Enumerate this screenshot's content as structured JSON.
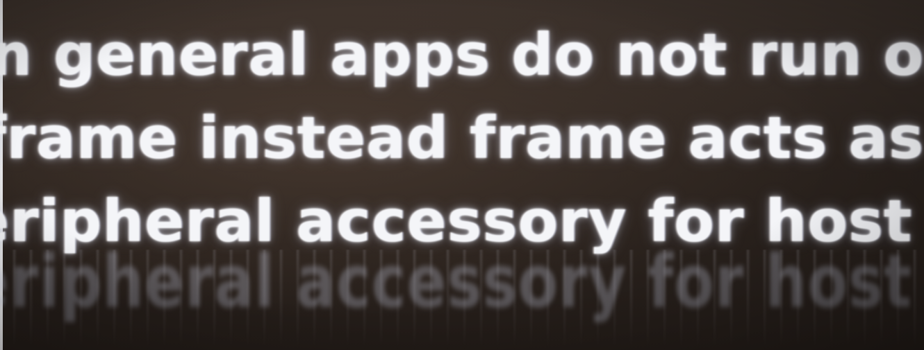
{
  "screen_text": {
    "line_1": "n general apps do not run on",
    "line_2": "frame instead frame acts as a",
    "line_3": "eripheral accessory for host"
  },
  "colors": {
    "text": "#f4f5f8",
    "background": "#2b2420"
  }
}
